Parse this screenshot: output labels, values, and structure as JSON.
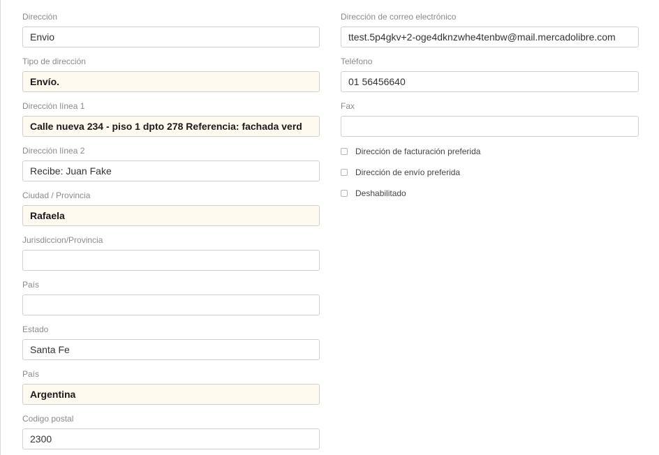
{
  "left_fields": [
    {
      "label": "Dirección",
      "value": "Envio",
      "required": false
    },
    {
      "label": "Tipo de dirección",
      "value": "Envío.",
      "required": true
    },
    {
      "label": "Dirección línea 1",
      "value": "Calle nueva 234 - piso 1 dpto 278 Referencia: fachada verd",
      "required": true
    },
    {
      "label": "Dirección línea 2",
      "value": "Recibe: Juan Fake",
      "required": false
    },
    {
      "label": "Ciudad / Provincia",
      "value": "Rafaela",
      "required": true
    },
    {
      "label": "Jurisdiccion/Provincia",
      "value": "",
      "required": false
    },
    {
      "label": "País",
      "value": "",
      "required": false
    },
    {
      "label": "Estado",
      "value": "Santa Fe",
      "required": false
    },
    {
      "label": "País",
      "value": "Argentina",
      "required": true
    },
    {
      "label": "Codigo postal",
      "value": "2300",
      "required": false
    }
  ],
  "right_fields": [
    {
      "label": "Dirección de correo electrónico",
      "value": "ttest.5p4gkv+2-oge4dknzwhe4tenbw@mail.mercadolibre.com",
      "required": false
    },
    {
      "label": "Teléfono",
      "value": "01 56456640",
      "required": false
    },
    {
      "label": "Fax",
      "value": "",
      "required": false
    }
  ],
  "checkboxes": [
    {
      "label": "Dirección de facturación preferida",
      "checked": false
    },
    {
      "label": "Dirección de envío preferida",
      "checked": false
    },
    {
      "label": "Deshabilitado",
      "checked": false
    }
  ]
}
